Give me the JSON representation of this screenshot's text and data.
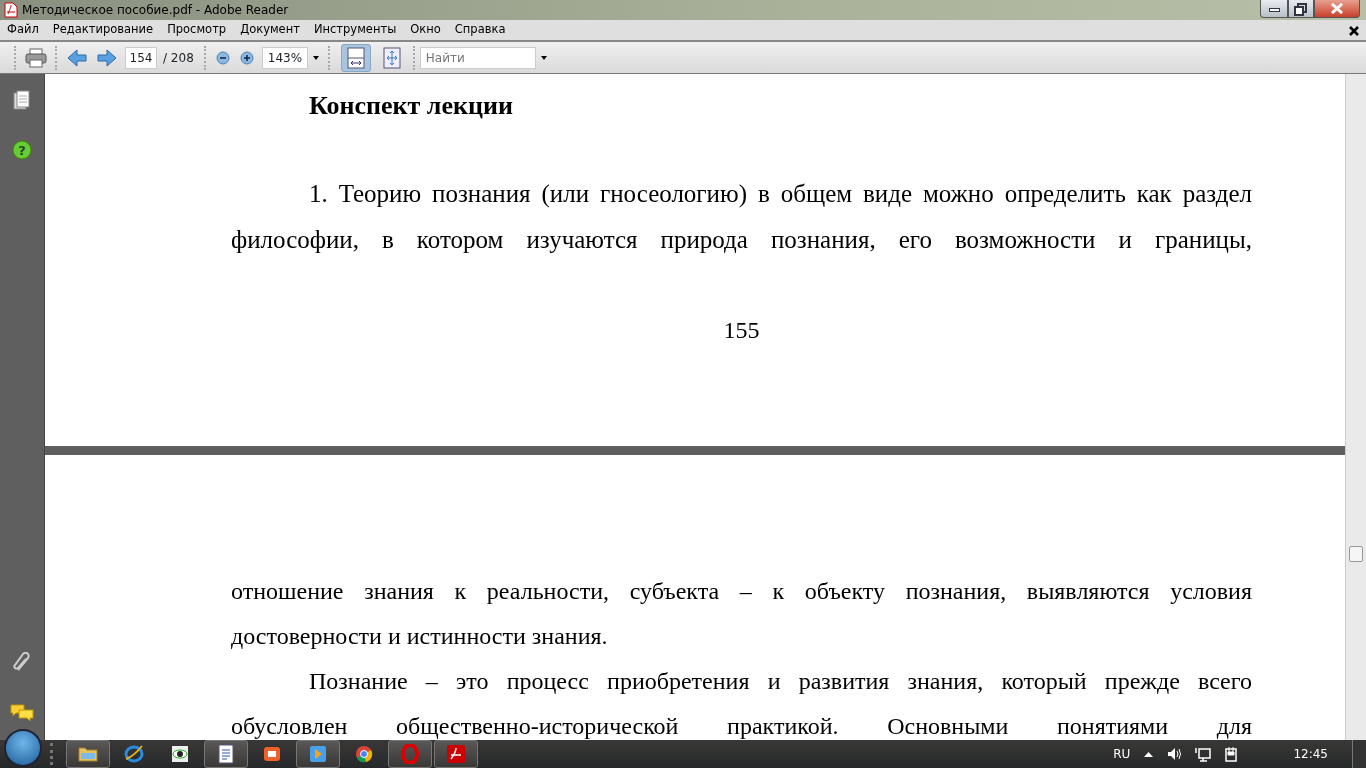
{
  "window": {
    "title": "Методическое пособие.pdf - Adobe Reader"
  },
  "sidebar": {
    "help_glyph": "?"
  },
  "menu": [
    "Файл",
    "Редактирование",
    "Просмотр",
    "Документ",
    "Инструменты",
    "Окно",
    "Справка"
  ],
  "toolbar": {
    "page": "154",
    "page_total": "/ 208",
    "zoom": "143%",
    "search_placeholder": "Найти",
    "fit_width_selected": true
  },
  "pages": [
    {
      "blocks": [
        {
          "kind": "heading",
          "text": "Конспект лекции"
        },
        {
          "kind": "line",
          "text": "1. Теорию познания (или гносеологию) в общем виде можно определить как раздел",
          "indent": true,
          "justify": true
        },
        {
          "kind": "line",
          "text": "философии, в котором изучаются природа познания, его возможности и границы,",
          "indent": false,
          "justify": true
        },
        {
          "kind": "page_number",
          "text": "155"
        }
      ]
    },
    {
      "blocks": [
        {
          "kind": "line",
          "text": "отношение знания к реальности, субъекта – к объекту познания, выявляются условия",
          "indent": false,
          "justify": true
        },
        {
          "kind": "line",
          "text": "достоверности и истинности знания.",
          "indent": false,
          "justify": false
        },
        {
          "kind": "line",
          "text": "Познание – это процесс приобретения и развития знания, который прежде всего",
          "indent": true,
          "justify": true
        },
        {
          "kind": "line",
          "text": "обусловлен общественно-исторической практикой. Основными понятиями для",
          "indent": false,
          "justify": true
        }
      ]
    }
  ],
  "taskbar": {
    "items": [
      {
        "kind": "folder",
        "running": true
      },
      {
        "kind": "ie",
        "running": false
      },
      {
        "kind": "eye",
        "running": false
      },
      {
        "kind": "word",
        "running": true
      },
      {
        "kind": "presentation",
        "running": false
      },
      {
        "kind": "media",
        "running": true
      },
      {
        "kind": "chrome",
        "running": false
      },
      {
        "kind": "opera",
        "running": true
      },
      {
        "kind": "reader",
        "running": true
      }
    ],
    "language": "RU",
    "clock": "12:45"
  }
}
